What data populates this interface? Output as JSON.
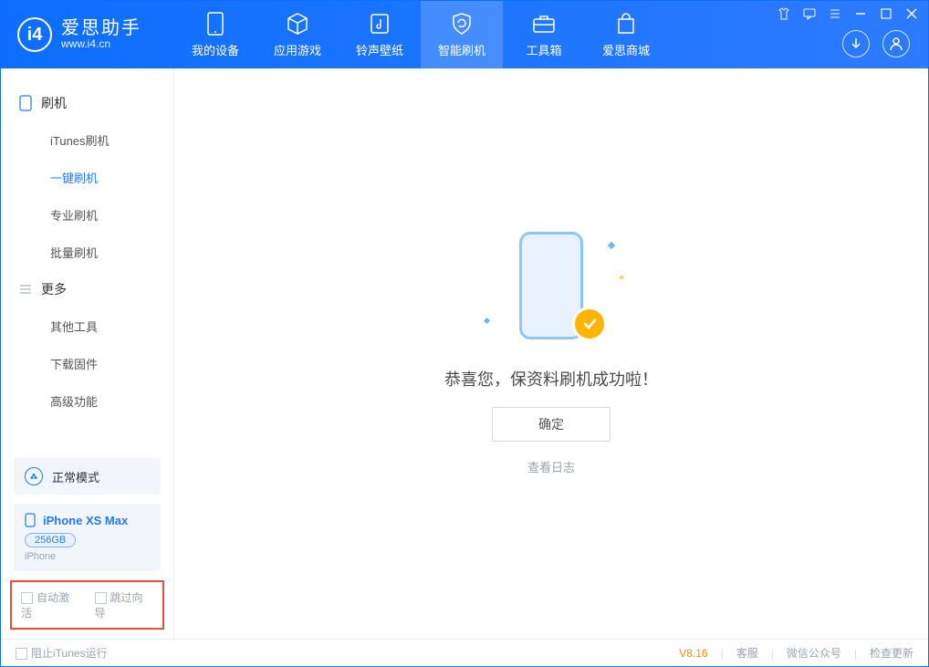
{
  "app": {
    "name_cn": "爱思助手",
    "name_en": "www.i4.cn"
  },
  "nav": [
    {
      "label": "我的设备"
    },
    {
      "label": "应用游戏"
    },
    {
      "label": "铃声壁纸"
    },
    {
      "label": "智能刷机"
    },
    {
      "label": "工具箱"
    },
    {
      "label": "爱思商城"
    }
  ],
  "sidebar": {
    "section1_title": "刷机",
    "section1_items": [
      "iTunes刷机",
      "一键刷机",
      "专业刷机",
      "批量刷机"
    ],
    "section2_title": "更多",
    "section2_items": [
      "其他工具",
      "下载固件",
      "高级功能"
    ]
  },
  "mode": {
    "label": "正常模式"
  },
  "device": {
    "name": "iPhone XS Max",
    "storage": "256GB",
    "type": "iPhone"
  },
  "options": {
    "auto_activate": "自动激活",
    "skip_wizard": "跳过向导"
  },
  "result": {
    "message": "恭喜您，保资料刷机成功啦！",
    "ok_button": "确定",
    "log_link": "查看日志"
  },
  "status": {
    "prevent_itunes": "阻止iTunes运行",
    "version": "V8.16",
    "links": [
      "客服",
      "微信公众号",
      "检查更新"
    ]
  }
}
